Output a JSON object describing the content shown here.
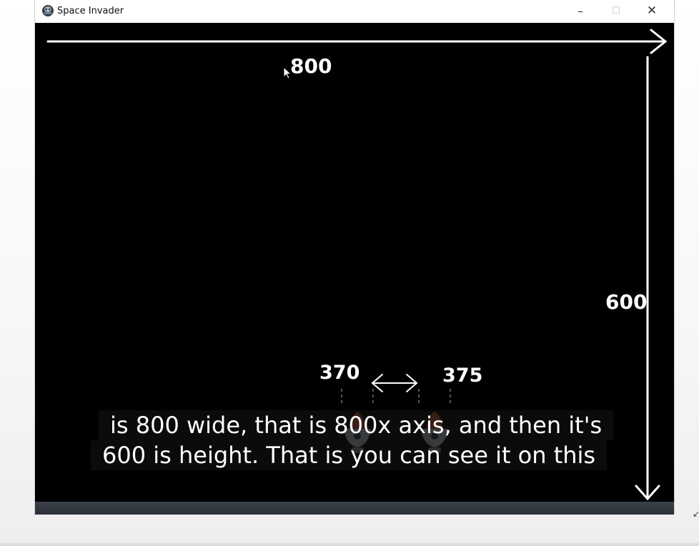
{
  "window": {
    "title": "Space Invader",
    "minimize_glyph": "–",
    "maximize_glyph": "☐",
    "close_glyph": "✕",
    "app_icon": "space-invader-icon"
  },
  "game": {
    "width_label": "800",
    "height_label": "600",
    "left_label": "370",
    "right_label": "375",
    "ship_icon": "player-spaceship-icon"
  },
  "captions": [
    "is 800 wide, that is 800x axis, and then it's",
    "600 is height. That is you can see it on this"
  ],
  "colors": {
    "canvas": "#000000",
    "annotation": "#ffffff",
    "caption_bg": "#0e0e0e",
    "ship_body": "#c9d3da",
    "ship_flame": "#d8553a"
  }
}
